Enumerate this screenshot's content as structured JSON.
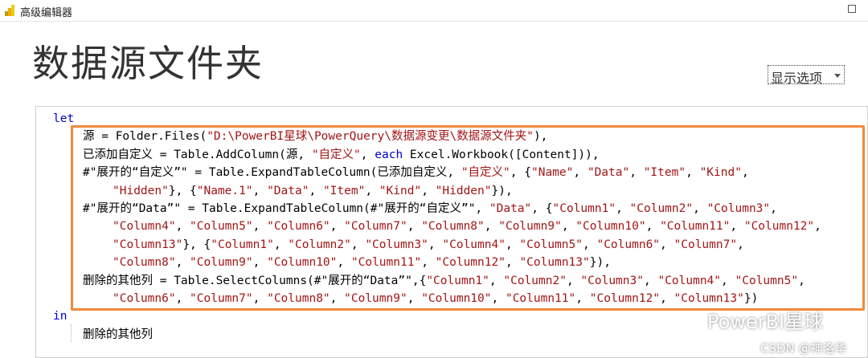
{
  "window": {
    "title": "高级编辑器"
  },
  "page_title": "数据源文件夹",
  "options": {
    "label": "显示选项"
  },
  "code": {
    "lines": [
      {
        "indent": 0,
        "tokens": [
          {
            "t": "let",
            "c": "kw"
          }
        ]
      },
      {
        "indent": 1,
        "tokens": [
          {
            "t": "源 = Folder.Files("
          },
          {
            "t": "\"D:\\PowerBI星球\\PowerQuery\\数据源变更\\数据源文件夹\"",
            "c": "str"
          },
          {
            "t": "),"
          }
        ]
      },
      {
        "indent": 1,
        "tokens": [
          {
            "t": "已添加自定义 = Table.AddColumn(源, "
          },
          {
            "t": "\"自定义\"",
            "c": "str"
          },
          {
            "t": ", "
          },
          {
            "t": "each",
            "c": "kw"
          },
          {
            "t": " Excel.Workbook([Content])),"
          }
        ]
      },
      {
        "indent": 1,
        "tokens": [
          {
            "t": "#\"展开的“自定义”\" = Table.ExpandTableColumn(已添加自定义, "
          },
          {
            "t": "\"自定义\"",
            "c": "str"
          },
          {
            "t": ", {"
          },
          {
            "t": "\"Name\"",
            "c": "str"
          },
          {
            "t": ", "
          },
          {
            "t": "\"Data\"",
            "c": "str"
          },
          {
            "t": ", "
          },
          {
            "t": "\"Item\"",
            "c": "str"
          },
          {
            "t": ", "
          },
          {
            "t": "\"Kind\"",
            "c": "str"
          },
          {
            "t": ","
          }
        ]
      },
      {
        "indent": 2,
        "tokens": [
          {
            "t": "\"Hidden\"",
            "c": "str"
          },
          {
            "t": "}, {"
          },
          {
            "t": "\"Name.1\"",
            "c": "str"
          },
          {
            "t": ", "
          },
          {
            "t": "\"Data\"",
            "c": "str"
          },
          {
            "t": ", "
          },
          {
            "t": "\"Item\"",
            "c": "str"
          },
          {
            "t": ", "
          },
          {
            "t": "\"Kind\"",
            "c": "str"
          },
          {
            "t": ", "
          },
          {
            "t": "\"Hidden\"",
            "c": "str"
          },
          {
            "t": "}),"
          }
        ]
      },
      {
        "indent": 1,
        "tokens": [
          {
            "t": "#\"展开的“Data”\" = Table.ExpandTableColumn(#\"展开的“自定义”\", "
          },
          {
            "t": "\"Data\"",
            "c": "str"
          },
          {
            "t": ", {"
          },
          {
            "t": "\"Column1\"",
            "c": "str"
          },
          {
            "t": ", "
          },
          {
            "t": "\"Column2\"",
            "c": "str"
          },
          {
            "t": ", "
          },
          {
            "t": "\"Column3\"",
            "c": "str"
          },
          {
            "t": ","
          }
        ]
      },
      {
        "indent": 2,
        "tokens": [
          {
            "t": "\"Column4\"",
            "c": "str"
          },
          {
            "t": ", "
          },
          {
            "t": "\"Column5\"",
            "c": "str"
          },
          {
            "t": ", "
          },
          {
            "t": "\"Column6\"",
            "c": "str"
          },
          {
            "t": ", "
          },
          {
            "t": "\"Column7\"",
            "c": "str"
          },
          {
            "t": ", "
          },
          {
            "t": "\"Column8\"",
            "c": "str"
          },
          {
            "t": ", "
          },
          {
            "t": "\"Column9\"",
            "c": "str"
          },
          {
            "t": ", "
          },
          {
            "t": "\"Column10\"",
            "c": "str"
          },
          {
            "t": ", "
          },
          {
            "t": "\"Column11\"",
            "c": "str"
          },
          {
            "t": ", "
          },
          {
            "t": "\"Column12\"",
            "c": "str"
          },
          {
            "t": ","
          }
        ]
      },
      {
        "indent": 2,
        "tokens": [
          {
            "t": "\"Column13\"",
            "c": "str"
          },
          {
            "t": "}, {"
          },
          {
            "t": "\"Column1\"",
            "c": "str"
          },
          {
            "t": ", "
          },
          {
            "t": "\"Column2\"",
            "c": "str"
          },
          {
            "t": ", "
          },
          {
            "t": "\"Column3\"",
            "c": "str"
          },
          {
            "t": ", "
          },
          {
            "t": "\"Column4\"",
            "c": "str"
          },
          {
            "t": ", "
          },
          {
            "t": "\"Column5\"",
            "c": "str"
          },
          {
            "t": ", "
          },
          {
            "t": "\"Column6\"",
            "c": "str"
          },
          {
            "t": ", "
          },
          {
            "t": "\"Column7\"",
            "c": "str"
          },
          {
            "t": ","
          }
        ]
      },
      {
        "indent": 2,
        "tokens": [
          {
            "t": "\"Column8\"",
            "c": "str"
          },
          {
            "t": ", "
          },
          {
            "t": "\"Column9\"",
            "c": "str"
          },
          {
            "t": ", "
          },
          {
            "t": "\"Column10\"",
            "c": "str"
          },
          {
            "t": ", "
          },
          {
            "t": "\"Column11\"",
            "c": "str"
          },
          {
            "t": ", "
          },
          {
            "t": "\"Column12\"",
            "c": "str"
          },
          {
            "t": ", "
          },
          {
            "t": "\"Column13\"",
            "c": "str"
          },
          {
            "t": "}),"
          }
        ]
      },
      {
        "indent": 1,
        "tokens": [
          {
            "t": "删除的其他列 = Table.SelectColumns(#\"展开的“Data”\",{"
          },
          {
            "t": "\"Column1\"",
            "c": "str"
          },
          {
            "t": ", "
          },
          {
            "t": "\"Column2\"",
            "c": "str"
          },
          {
            "t": ", "
          },
          {
            "t": "\"Column3\"",
            "c": "str"
          },
          {
            "t": ", "
          },
          {
            "t": "\"Column4\"",
            "c": "str"
          },
          {
            "t": ", "
          },
          {
            "t": "\"Column5\"",
            "c": "str"
          },
          {
            "t": ","
          }
        ]
      },
      {
        "indent": 2,
        "tokens": [
          {
            "t": "\"Column6\"",
            "c": "str"
          },
          {
            "t": ", "
          },
          {
            "t": "\"Column7\"",
            "c": "str"
          },
          {
            "t": ", "
          },
          {
            "t": "\"Column8\"",
            "c": "str"
          },
          {
            "t": ", "
          },
          {
            "t": "\"Column9\"",
            "c": "str"
          },
          {
            "t": ", "
          },
          {
            "t": "\"Column10\"",
            "c": "str"
          },
          {
            "t": ", "
          },
          {
            "t": "\"Column11\"",
            "c": "str"
          },
          {
            "t": ", "
          },
          {
            "t": "\"Column12\"",
            "c": "str"
          },
          {
            "t": ", "
          },
          {
            "t": "\"Column13\"",
            "c": "str"
          },
          {
            "t": "})"
          }
        ]
      },
      {
        "indent": 0,
        "tokens": [
          {
            "t": "in",
            "c": "kw"
          }
        ]
      },
      {
        "indent": 1,
        "tokens": [
          {
            "t": "删除的其他列"
          }
        ]
      }
    ]
  },
  "watermark": {
    "text": "PowerBI星球",
    "sub": "CSDN @神洛华"
  },
  "colors": {
    "keyword": "#0000cc",
    "string": "#a31515",
    "highlight": "#f08a3c",
    "app_icon": "#f2c811"
  },
  "icons": {
    "app": "powerbi-icon",
    "maximize": "maximize-icon",
    "dropdown": "chevron-down-icon",
    "wechat": "wechat-icon"
  }
}
